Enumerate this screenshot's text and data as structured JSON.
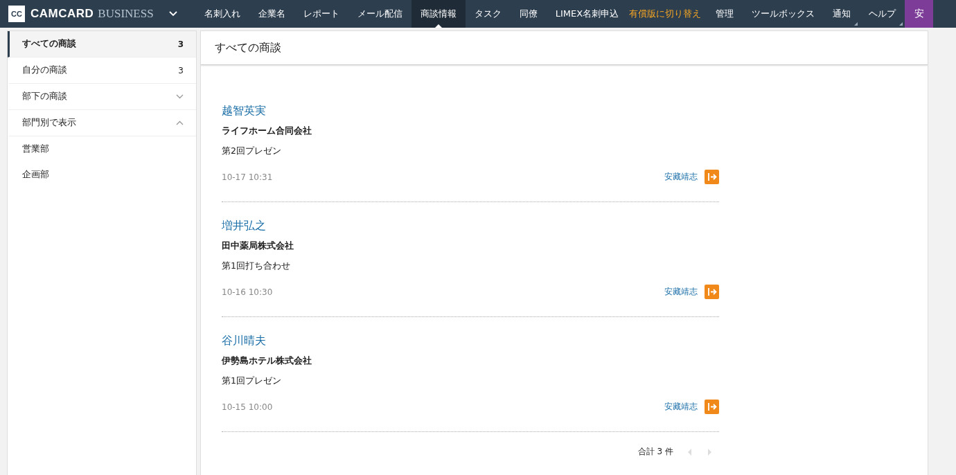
{
  "brand": {
    "logo": "CC",
    "name_bold": "CAMCARD",
    "name_light": "BUSINESS"
  },
  "nav": [
    {
      "label": "名刺入れ",
      "selected": false
    },
    {
      "label": "企業名",
      "selected": false
    },
    {
      "label": "レポート",
      "selected": false
    },
    {
      "label": "メール配信",
      "selected": false
    },
    {
      "label": "商談情報",
      "selected": true
    },
    {
      "label": "タスク",
      "selected": false
    },
    {
      "label": "同僚",
      "selected": false
    },
    {
      "label": "LIMEX名刺申込",
      "selected": false
    }
  ],
  "upgrade_link": "有償版に切り替え",
  "nav_right": [
    {
      "label": "管理",
      "corner": false
    },
    {
      "label": "ツールボックス",
      "corner": false
    },
    {
      "label": "通知",
      "corner": true
    },
    {
      "label": "ヘルプ",
      "corner": true
    }
  ],
  "user_avatar": "安",
  "sidebar": {
    "items": [
      {
        "label": "すべての商談",
        "count": "3",
        "selected": true
      },
      {
        "label": "自分の商談",
        "count": "3",
        "selected": false
      },
      {
        "label": "部下の商談",
        "selected": false,
        "expanded": false
      },
      {
        "label": "部門別で表示",
        "selected": false,
        "expanded": true,
        "children": [
          {
            "label": "営業部",
            "selected": false
          },
          {
            "label": "企画部",
            "selected": false
          }
        ]
      }
    ]
  },
  "panel": {
    "title": "すべての商談",
    "deals": [
      {
        "contact": "越智英実",
        "company": "ライフホーム合同会社",
        "subject": "第2回プレゼン",
        "time": "10-17 10:31",
        "owner": "安藏靖志"
      },
      {
        "contact": "増井弘之",
        "company": "田中薬局株式会社",
        "subject": "第1回打ち合わせ",
        "time": "10-16 10:30",
        "owner": "安藏靖志"
      },
      {
        "contact": "谷川晴夫",
        "company": "伊勢島ホテル株式会社",
        "subject": "第1回プレゼン",
        "time": "10-15 10:00",
        "owner": "安藏靖志"
      }
    ],
    "total": "合計 3 件"
  }
}
